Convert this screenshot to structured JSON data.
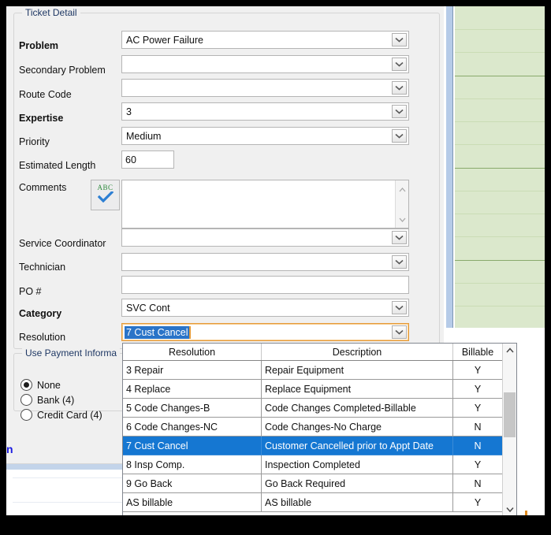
{
  "window": {
    "form_group_title": "Ticket Detail",
    "payment_group_title": "Use Payment Informa"
  },
  "form": {
    "fields": [
      {
        "label": "Problem",
        "bold": true,
        "value": "AC Power Failure",
        "control": "combo"
      },
      {
        "label": "Secondary Problem",
        "bold": false,
        "value": "",
        "control": "combo"
      },
      {
        "label": "Route Code",
        "bold": false,
        "value": "",
        "control": "combo"
      },
      {
        "label": "Expertise",
        "bold": true,
        "value": "3",
        "control": "combo"
      },
      {
        "label": "Priority",
        "bold": false,
        "value": "Medium",
        "control": "combo"
      },
      {
        "label": "Estimated Length",
        "bold": false,
        "value": "60",
        "control": "textbox"
      },
      {
        "label": "Comments",
        "bold": false,
        "value": "",
        "control": "textarea"
      },
      {
        "label": "Service Coordinator",
        "bold": false,
        "value": "",
        "control": "combo"
      },
      {
        "label": "Technician",
        "bold": false,
        "value": "",
        "control": "combo"
      },
      {
        "label": "PO #",
        "bold": false,
        "value": "",
        "control": "textbox"
      },
      {
        "label": "Category",
        "bold": true,
        "value": "SVC Cont",
        "control": "combo"
      },
      {
        "label": "Resolution",
        "bold": false,
        "value": "7 Cust Cancel",
        "control": "combo-focused"
      }
    ],
    "spellcheck_label": "ABC"
  },
  "payment": {
    "options": [
      {
        "label": "None",
        "selected": true
      },
      {
        "label": "Bank (4)",
        "selected": false
      },
      {
        "label": "Credit Card (4)",
        "selected": false
      }
    ]
  },
  "link_fragment": "n",
  "dropdown": {
    "columns": [
      "Resolution",
      "Description",
      "Billable"
    ],
    "rows": [
      {
        "resolution": "3 Repair",
        "description": "Repair Equipment",
        "billable": "Y",
        "selected": false
      },
      {
        "resolution": "4 Replace",
        "description": "Replace Equipment",
        "billable": "Y",
        "selected": false
      },
      {
        "resolution": "5 Code Changes-B",
        "description": "Code Changes Completed-Billable",
        "billable": "Y",
        "selected": false
      },
      {
        "resolution": "6 Code Changes-NC",
        "description": "Code Changes-No Charge",
        "billable": "N",
        "selected": false
      },
      {
        "resolution": "7 Cust Cancel",
        "description": "Customer Cancelled prior to Appt Date",
        "billable": "N",
        "selected": true
      },
      {
        "resolution": "8 Insp Comp.",
        "description": "Inspection Completed",
        "billable": "Y",
        "selected": false
      },
      {
        "resolution": "9 Go Back",
        "description": "Go Back Required",
        "billable": "N",
        "selected": false
      },
      {
        "resolution": "AS billable",
        "description": "AS billable",
        "billable": "Y",
        "selected": false
      }
    ]
  },
  "colors": {
    "selection_blue": "#1577d2",
    "focus_orange": "#e59b3a",
    "group_title": "#1f3864",
    "schedule_green": "#dbe8cc",
    "link_blue": "#1a1ae0"
  }
}
